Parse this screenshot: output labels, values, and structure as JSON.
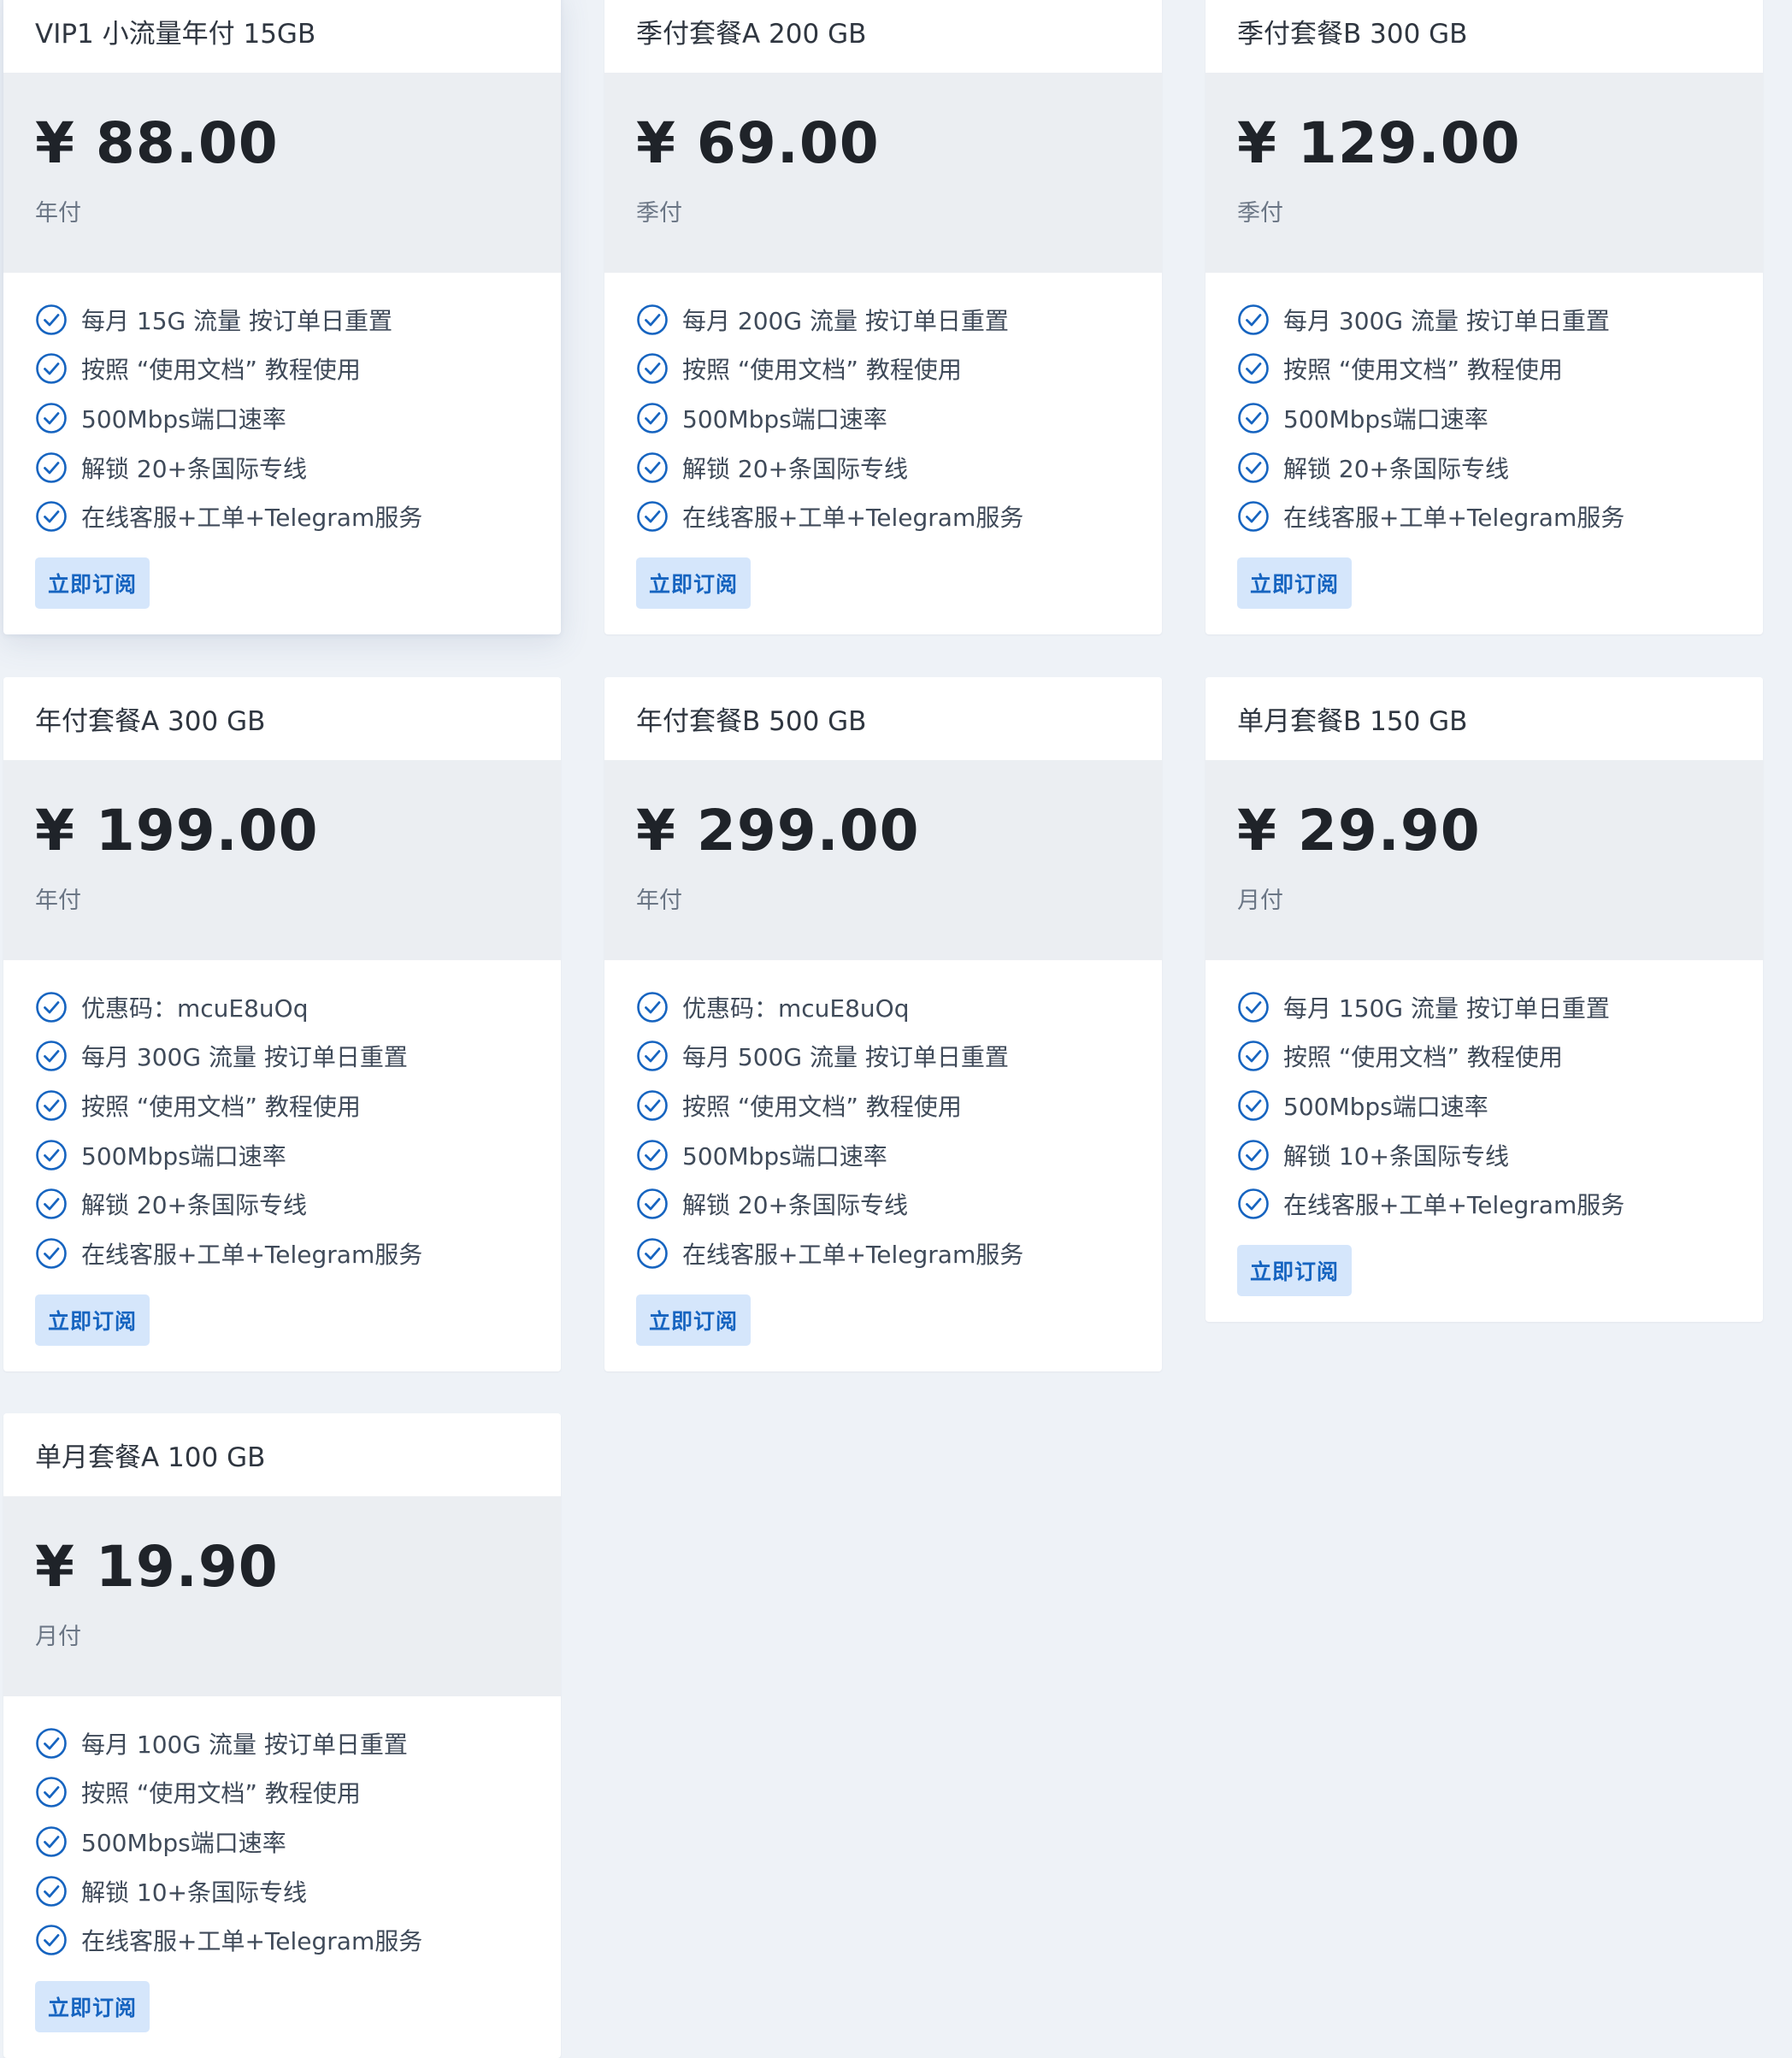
{
  "plans": [
    {
      "title": "VIP1 小流量年付 15GB",
      "price": "¥ 88.00",
      "period": "年付",
      "features": [
        "每月 15G 流量 按订单日重置",
        "按照 “使用文档” 教程使用",
        "500Mbps端口速率",
        "解锁 20+条国际专线",
        "在线客服+工单+Telegram服务"
      ],
      "button": "立即订阅"
    },
    {
      "title": "季付套餐A 200 GB",
      "price": "¥ 69.00",
      "period": "季付",
      "features": [
        "每月 200G 流量 按订单日重置",
        "按照 “使用文档” 教程使用",
        "500Mbps端口速率",
        "解锁 20+条国际专线",
        "在线客服+工单+Telegram服务"
      ],
      "button": "立即订阅"
    },
    {
      "title": "季付套餐B 300 GB",
      "price": "¥ 129.00",
      "period": "季付",
      "features": [
        "每月 300G 流量 按订单日重置",
        "按照 “使用文档” 教程使用",
        "500Mbps端口速率",
        "解锁 20+条国际专线",
        "在线客服+工单+Telegram服务"
      ],
      "button": "立即订阅"
    },
    {
      "title": "年付套餐A 300 GB",
      "price": "¥ 199.00",
      "period": "年付",
      "features": [
        "优惠码：mcuE8uOq",
        "每月 300G 流量 按订单日重置",
        "按照 “使用文档” 教程使用",
        "500Mbps端口速率",
        "解锁 20+条国际专线",
        "在线客服+工单+Telegram服务"
      ],
      "button": "立即订阅"
    },
    {
      "title": "年付套餐B 500 GB",
      "price": "¥ 299.00",
      "period": "年付",
      "features": [
        "优惠码：mcuE8uOq",
        "每月 500G 流量 按订单日重置",
        "按照 “使用文档” 教程使用",
        "500Mbps端口速率",
        "解锁 20+条国际专线",
        "在线客服+工单+Telegram服务"
      ],
      "button": "立即订阅"
    },
    {
      "title": "单月套餐B 150 GB",
      "price": "¥ 29.90",
      "period": "月付",
      "features": [
        "每月 150G 流量 按订单日重置",
        "按照 “使用文档” 教程使用",
        "500Mbps端口速率",
        "解锁 10+条国际专线",
        "在线客服+工单+Telegram服务"
      ],
      "button": "立即订阅"
    },
    {
      "title": "单月套餐A 100 GB",
      "price": "¥ 19.90",
      "period": "月付",
      "features": [
        "每月 100G 流量 按订单日重置",
        "按照 “使用文档” 教程使用",
        "500Mbps端口速率",
        "解锁 10+条国际专线",
        "在线客服+工单+Telegram服务"
      ],
      "button": "立即订阅"
    }
  ],
  "icons": {
    "feature": "check-circle-icon"
  },
  "colors": {
    "background": "#eef2f7",
    "accent": "#1664c0",
    "button_bg": "#d5e6fb",
    "price_block": "#ebeef2"
  }
}
